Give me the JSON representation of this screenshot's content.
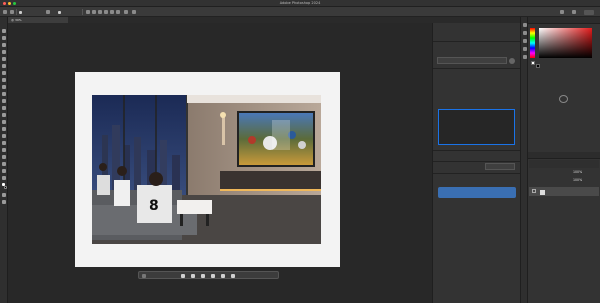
{
  "title_bar": {
    "app_title": "Adobe Photoshop 2024"
  },
  "doc_tab": {
    "label": "@ 39%"
  },
  "context_bar": {
    "action": ""
  },
  "generative_panel": {
    "header": "",
    "tabs": [
      "",
      "",
      ""
    ],
    "model_label": "",
    "model_badge": "",
    "style_dropdown": "",
    "prompt_section": "",
    "prompt_tabs": [
      "",
      ""
    ],
    "prompt_text": "",
    "reference_label": "",
    "reference_value": "",
    "quantity_label": "",
    "quantity_value": "",
    "advanced_label": "",
    "generate_button": ""
  },
  "right_panel": {
    "color_tabs": [
      "",
      ""
    ],
    "cc_text": "",
    "layers_tabs": [
      "",
      "",
      ""
    ],
    "layer_mode": "",
    "opacity_label": "",
    "opacity_value": "100%",
    "fill_label": "",
    "fill_value": "100%",
    "layer_name": ""
  },
  "colors": {
    "accent": "#3a6fb3",
    "prompt_border": "#1a73e8",
    "panel_bg": "#333333"
  }
}
